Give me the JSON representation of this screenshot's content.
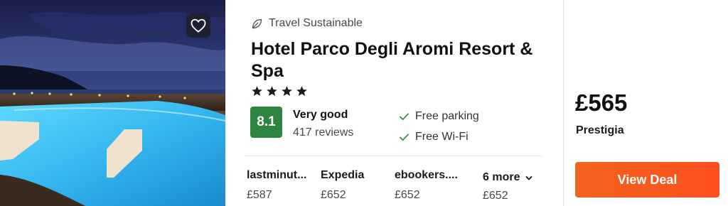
{
  "hotel": {
    "sustainability_label": "Travel Sustainable",
    "name": "Hotel Parco Degli Aromi Resort & Spa",
    "stars": 4,
    "rating_score": "8.1",
    "rating_label": "Very good",
    "review_count": "417 reviews",
    "amenities": [
      "Free parking",
      "Free Wi-Fi"
    ]
  },
  "providers": [
    {
      "name": "lastminut...",
      "price": "£587"
    },
    {
      "name": "Expedia",
      "price": "£652"
    },
    {
      "name": "ebookers....",
      "price": "£652"
    }
  ],
  "more": {
    "label": "6 more",
    "price": "£652"
  },
  "deal": {
    "price": "£565",
    "provider": "Prestigia",
    "button_label": "View Deal"
  },
  "icons": {
    "favorite": "heart-icon",
    "sustainability": "leaf-icon",
    "star": "star-icon",
    "check": "check-icon",
    "more": "chevron-down-icon"
  },
  "colors": {
    "rating_badge": "#2e8540",
    "deal_button": "#ff5a1f",
    "check": "#2e8540"
  }
}
